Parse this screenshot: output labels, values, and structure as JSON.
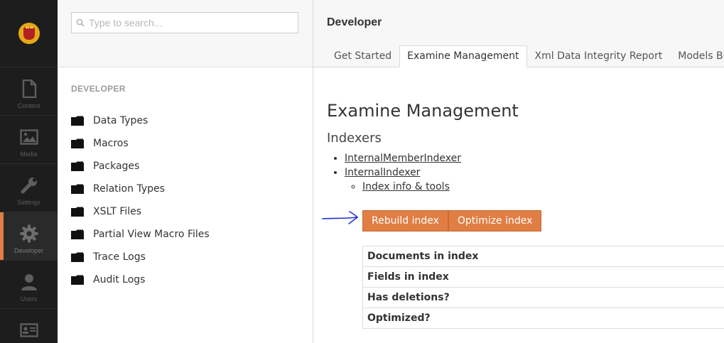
{
  "rail": {
    "items": [
      {
        "label": "Content",
        "icon": "document-icon"
      },
      {
        "label": "Media",
        "icon": "image-icon"
      },
      {
        "label": "Settings",
        "icon": "wrench-icon"
      },
      {
        "label": "Developer",
        "icon": "gear-icon"
      },
      {
        "label": "Users",
        "icon": "user-icon"
      },
      {
        "label": "",
        "icon": "id-card-icon"
      }
    ],
    "active": "Developer",
    "accent": "#e07e44"
  },
  "tree": {
    "search_placeholder": "Type to search...",
    "heading": "DEVELOPER",
    "items": [
      {
        "label": "Data Types"
      },
      {
        "label": "Macros"
      },
      {
        "label": "Packages"
      },
      {
        "label": "Relation Types"
      },
      {
        "label": "XSLT Files"
      },
      {
        "label": "Partial View Macro Files"
      },
      {
        "label": "Trace Logs"
      },
      {
        "label": "Audit Logs"
      }
    ]
  },
  "header": {
    "title": "Developer",
    "tabs": [
      {
        "label": "Get Started"
      },
      {
        "label": "Examine Management"
      },
      {
        "label": "Xml Data Integrity Report"
      },
      {
        "label": "Models Builder"
      }
    ],
    "active_tab": "Examine Management"
  },
  "main": {
    "title": "Examine Management",
    "subtitle": "Indexers",
    "indexers": [
      {
        "label": "InternalMemberIndexer"
      },
      {
        "label": "InternalIndexer"
      }
    ],
    "sub_link": "Index info & tools",
    "buttons": {
      "rebuild": "Rebuild index",
      "optimize": "Optimize index"
    },
    "stats": [
      {
        "label": "Documents in index"
      },
      {
        "label": "Fields in index"
      },
      {
        "label": "Has deletions?"
      },
      {
        "label": "Optimized?"
      }
    ]
  },
  "colors": {
    "rail_bg": "#1d1d1d",
    "button": "#e07e44",
    "arrow": "#1f2fd6"
  }
}
